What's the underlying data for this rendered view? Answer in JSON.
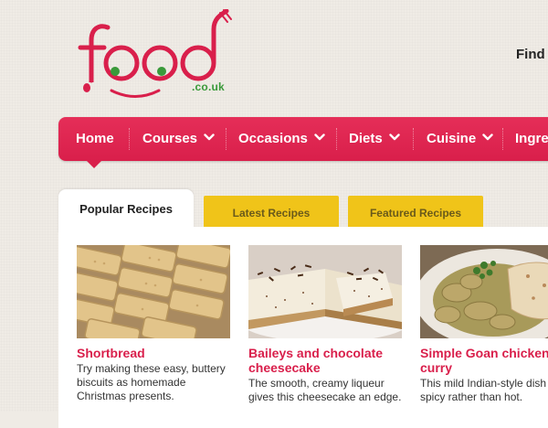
{
  "logo": {
    "name": "food",
    "tld": ".co.uk"
  },
  "header": {
    "find_text": "Find"
  },
  "nav": {
    "items": [
      {
        "label": "Home"
      },
      {
        "label": "Courses"
      },
      {
        "label": "Occasions"
      },
      {
        "label": "Diets"
      },
      {
        "label": "Cuisine"
      },
      {
        "label": "Ingre"
      }
    ]
  },
  "tabs": [
    {
      "label": "Popular Recipes"
    },
    {
      "label": "Latest Recipes"
    },
    {
      "label": "Featured Recipes"
    }
  ],
  "recipes": [
    {
      "title": "Shortbread",
      "desc": "Try making these easy, buttery biscuits as homemade Christmas presents."
    },
    {
      "title": "Baileys and chocolate cheesecake",
      "desc": "The smooth, creamy liqueur gives this cheesecake an edge."
    },
    {
      "title": "Simple Goan chicken curry",
      "desc": "This mild Indian-style dish spicy rather than hot."
    }
  ],
  "colors": {
    "brand": "#d91f4b",
    "tab_yellow": "#f0c419",
    "logo_green": "#3a9a3a"
  }
}
